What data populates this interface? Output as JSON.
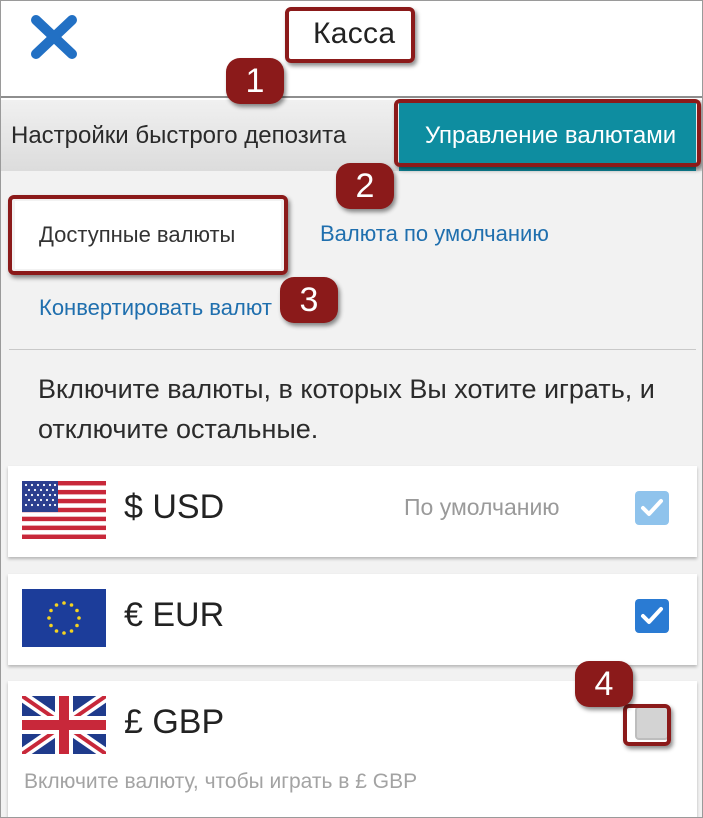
{
  "header": {
    "title": "Касса",
    "close_icon": "close-icon"
  },
  "tabs": [
    {
      "label": "Настройки быстрого депозита"
    },
    {
      "label": "Управление валютами",
      "active": true
    }
  ],
  "subtabs": {
    "available": "Доступные валюты",
    "default": "Валюта по умолчанию",
    "convert": "Конвертировать валют"
  },
  "intro_text": "Включите валюты, в которых Вы хотите играть, и отключите остальные.",
  "currencies": [
    {
      "code": "$ USD",
      "flag": "us-flag",
      "default_label": "По умолчанию",
      "checked": true
    },
    {
      "code": "€ EUR",
      "flag": "eu-flag",
      "checked": true
    },
    {
      "code": "£ GBP",
      "flag": "uk-flag",
      "checked": false,
      "hint": "Включите валюту, чтобы играть в £ GBP"
    }
  ],
  "annotations": [
    "1",
    "2",
    "3",
    "4"
  ],
  "colors": {
    "accent": "#0e8da0",
    "annotation": "#8b1a1a",
    "link": "#1f6fae",
    "checkbox": "#2a7bd3"
  }
}
